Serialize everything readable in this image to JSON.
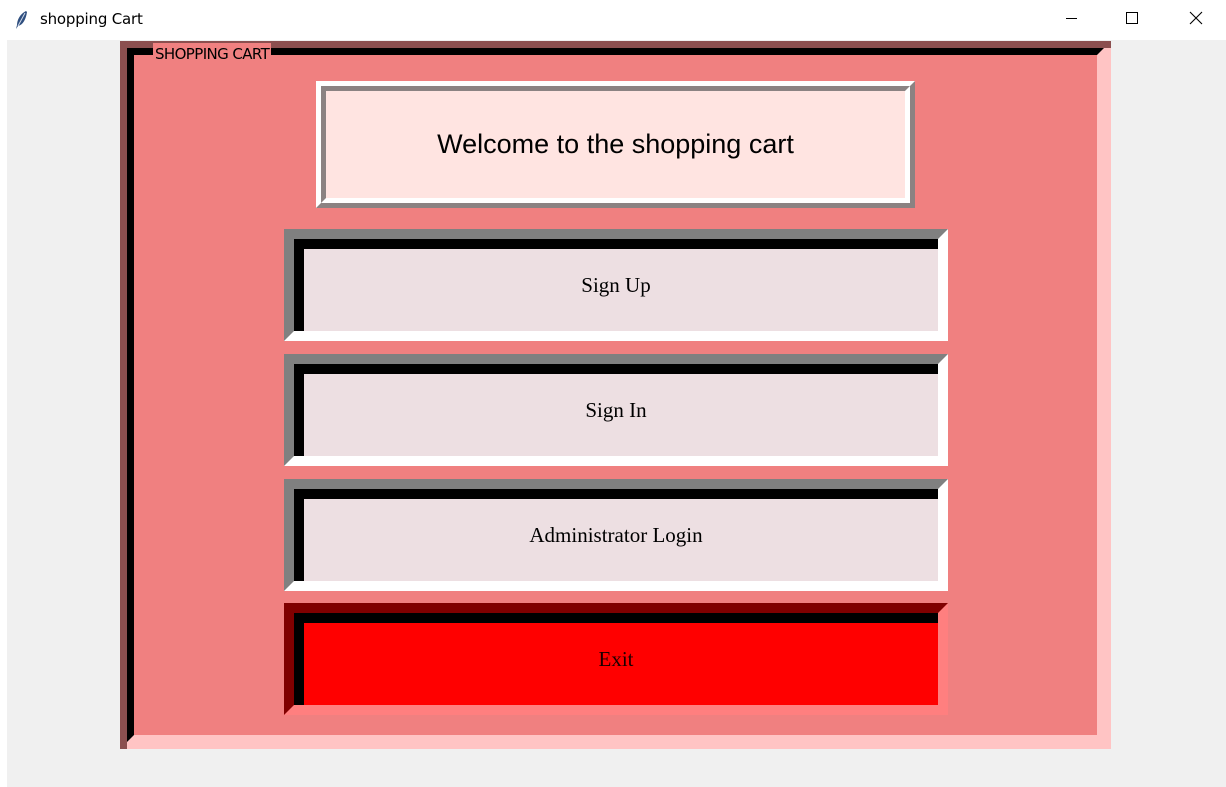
{
  "window": {
    "title": "shopping Cart",
    "icon": "feather-icon",
    "controls": [
      "minimize-icon",
      "maximize-icon",
      "close-icon"
    ]
  },
  "frame": {
    "label": "SHOPPING CART",
    "background": "#f08080"
  },
  "welcome": {
    "text": "Welcome to the shopping cart",
    "background": "#ffe4e1"
  },
  "buttons": {
    "sign_up": "Sign Up",
    "sign_in": "Sign In",
    "admin_login": "Administrator Login",
    "exit": "Exit"
  },
  "colors": {
    "button_background": "#eddfe2",
    "exit_background": "#ff0000"
  }
}
